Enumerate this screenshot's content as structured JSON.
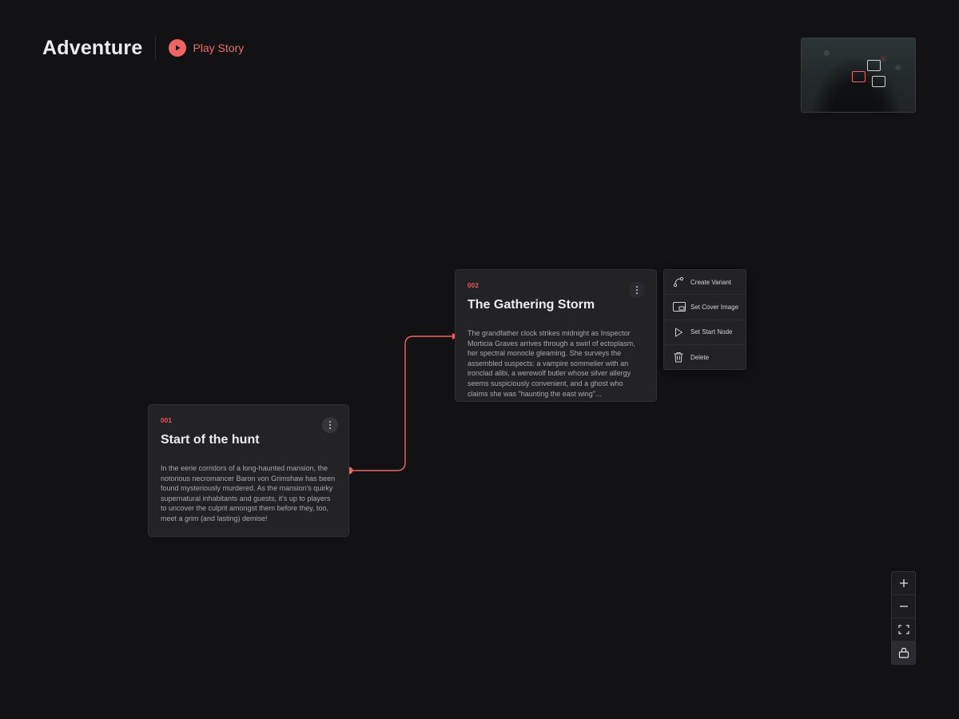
{
  "header": {
    "title": "Adventure",
    "play_label": "Play Story"
  },
  "colors": {
    "background": "#121214",
    "accent": "#f06463",
    "node_bg": "#232326",
    "text_primary": "#ececee",
    "text_secondary": "#a9a9ad"
  },
  "nodes": [
    {
      "number": "001",
      "title": "Start of the hunt",
      "body": "In the eerie corridors of a long-haunted mansion, the notorious necromancer Baron von Grimshaw has been found mysteriously murdered. As the mansion's quirky supernatural inhabitants and guests, it's up to players to uncover the culprit amongst them before they, too, meet a grim (and lasting) demise!"
    },
    {
      "number": "002",
      "title": "The Gathering Storm",
      "body": "The grandfather clock strikes midnight as Inspector Morticia Graves arrives through a swirl of ectoplasm, her spectral monocle gleaming. She surveys the assembled suspects: a vampire sommelier with an ironclad alibi, a werewolf butler whose silver allergy seems suspiciously convenient, and a ghost who claims she was \"haunting the east wing\"..."
    }
  ],
  "context_menu": {
    "items": [
      {
        "label": "Create Variant",
        "icon": "branch-icon"
      },
      {
        "label": "Set Cover Image",
        "icon": "image-icon"
      },
      {
        "label": "Set Start Node",
        "icon": "play-outline-icon"
      },
      {
        "label": "Delete",
        "icon": "trash-icon"
      }
    ]
  },
  "zoom_controls": {
    "items": [
      "zoom-in-icon",
      "zoom-out-icon",
      "fit-view-icon",
      "lock-icon"
    ]
  }
}
